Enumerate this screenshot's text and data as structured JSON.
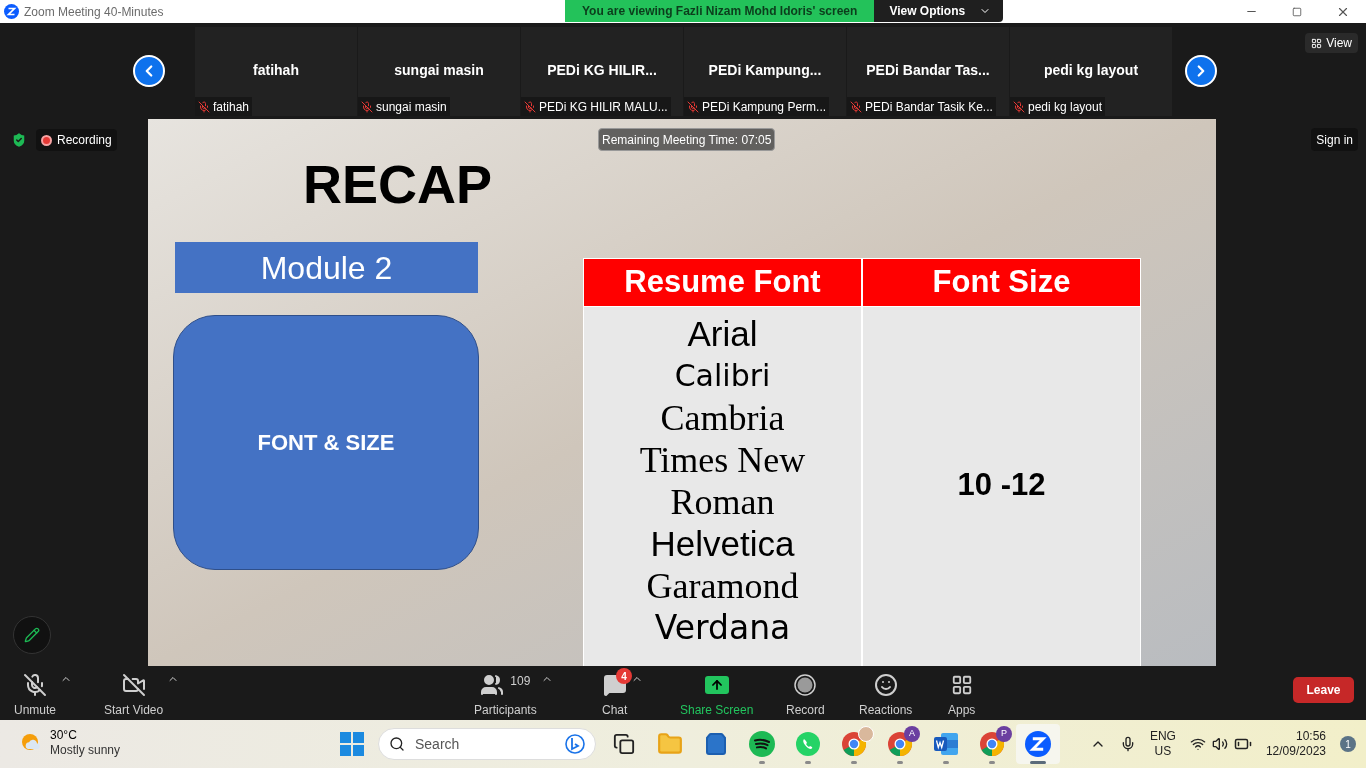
{
  "window": {
    "title": "Zoom Meeting 40-Minutes"
  },
  "share_banner": {
    "text": "You are viewing Fazli Nizam Mohd Idoris' screen",
    "button": "View Options"
  },
  "view_button": "View",
  "participants": [
    {
      "name": "fatihah",
      "label": "fatihah",
      "muted": true
    },
    {
      "name": "sungai masin",
      "label": "sungai masin",
      "muted": true
    },
    {
      "name": "PEDi KG HILIR...",
      "label": "PEDi KG HILIR MALU...",
      "muted": true
    },
    {
      "name": "PEDi  Kampung...",
      "label": "PEDi Kampung Perm...",
      "muted": true
    },
    {
      "name": "PEDi  Bandar Tas...",
      "label": "PEDi Bandar Tasik Ke...",
      "muted": true
    },
    {
      "name": "pedi kg layout",
      "label": "pedi kg layout",
      "muted": true
    }
  ],
  "recording": "Recording",
  "sign_in": "Sign in",
  "remaining_time": "Remaining Meeting Time: 07:05",
  "slide": {
    "title": "RECAP",
    "module": "Module 2",
    "topic": "FONT & SIZE",
    "table": {
      "columns": [
        "Resume Font",
        "Font Size"
      ],
      "fonts": [
        {
          "name": "Arial",
          "kind": "sans"
        },
        {
          "name": "Calibri",
          "kind": "narrow"
        },
        {
          "name": "Cambria",
          "kind": "serif"
        },
        {
          "name": "Times New Roman",
          "kind": "serif"
        },
        {
          "name": "Helvetica",
          "kind": "sans"
        },
        {
          "name": "Garamond",
          "kind": "serif"
        },
        {
          "name": "Verdana",
          "kind": "wide"
        }
      ],
      "size": "10 -12"
    }
  },
  "toolbar": [
    {
      "kind": "mic",
      "label": "Unmute",
      "off": true,
      "caret": true
    },
    {
      "kind": "video",
      "label": "Start Video",
      "off": true,
      "caret": true
    },
    {
      "kind": "participants",
      "label": "Participants",
      "count": "109",
      "caret": true
    },
    {
      "kind": "chat",
      "label": "Chat",
      "badge": "4",
      "caret": true
    },
    {
      "kind": "share",
      "label": "Share Screen"
    },
    {
      "kind": "record",
      "label": "Record"
    },
    {
      "kind": "reactions",
      "label": "Reactions"
    },
    {
      "kind": "apps",
      "label": "Apps"
    }
  ],
  "leave": "Leave",
  "taskbar": {
    "weather": {
      "temp": "30°C",
      "condition": "Mostly sunny"
    },
    "search_placeholder": "Search",
    "apps": [
      {
        "kind": "taskview",
        "running": false,
        "selected": false
      },
      {
        "kind": "explorer",
        "running": false,
        "selected": false
      },
      {
        "kind": "store",
        "running": false,
        "selected": false
      },
      {
        "kind": "spotify",
        "running": true,
        "selected": false
      },
      {
        "kind": "whatsapp",
        "running": true,
        "selected": false
      },
      {
        "kind": "chrome",
        "running": true,
        "avatar": true,
        "selected": false
      },
      {
        "kind": "chrome",
        "running": true,
        "badge": "A",
        "selected": false
      },
      {
        "kind": "word",
        "running": true,
        "selected": false
      },
      {
        "kind": "chrome",
        "running": true,
        "badge": "P",
        "selected": false
      },
      {
        "kind": "zoom",
        "running": true,
        "selected": true
      }
    ],
    "language": "ENG",
    "region": "US",
    "time": "10:56",
    "date": "12/09/2023",
    "notifications": "1"
  }
}
